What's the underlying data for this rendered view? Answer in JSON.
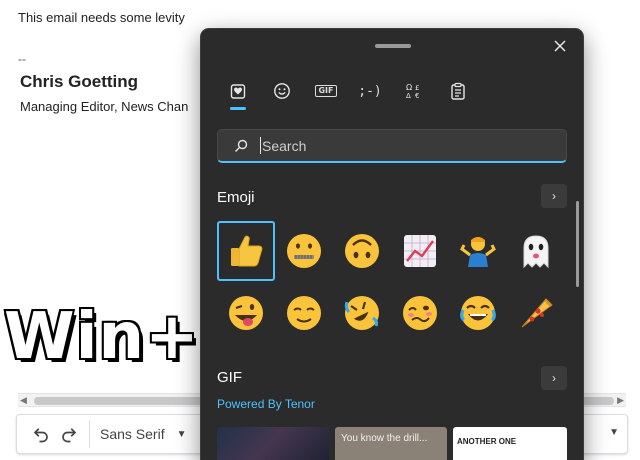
{
  "email": {
    "body_text": "This email needs some levity",
    "sig_dashes": "--",
    "sig_name": "Chris Goetting",
    "sig_title": "Managing Editor, News Chan"
  },
  "overlay_text": "Win+.",
  "toolbar": {
    "font_name": "Sans Serif",
    "undo_icon": "undo-icon",
    "redo_icon": "redo-icon"
  },
  "panel": {
    "tabs": [
      {
        "name": "recent-tab",
        "icon": "heart-clipboard-icon",
        "active": true
      },
      {
        "name": "emoji-tab",
        "icon": "smiley-icon"
      },
      {
        "name": "gif-tab",
        "label": "GIF"
      },
      {
        "name": "kaomoji-tab",
        "label": ";-)"
      },
      {
        "name": "symbols-tab",
        "label": "Ω"
      },
      {
        "name": "clipboard-tab",
        "icon": "clipboard-icon"
      }
    ],
    "search_placeholder": "Search",
    "emoji_section_title": "Emoji",
    "gif_section_title": "GIF",
    "powered_by": "Powered By Tenor",
    "emojis": [
      {
        "name": "thumbs-up",
        "char": "👍",
        "selected": true
      },
      {
        "name": "zipper-mouth",
        "char": "🤐"
      },
      {
        "name": "upside-down",
        "char": "🙃"
      },
      {
        "name": "chart-increasing",
        "char": "📈"
      },
      {
        "name": "person-shrugging",
        "char": "🤷"
      },
      {
        "name": "ghost",
        "char": "👻"
      },
      {
        "name": "winking-tongue",
        "char": "😜"
      },
      {
        "name": "relieved",
        "char": "😌"
      },
      {
        "name": "rolling-laughing",
        "char": "🤣"
      },
      {
        "name": "woozy",
        "char": "🥴"
      },
      {
        "name": "joy",
        "char": "😂"
      },
      {
        "name": "pizza",
        "char": "🍕"
      }
    ],
    "gifs": [
      {
        "caption": ""
      },
      {
        "caption": "You know the drill..."
      },
      {
        "caption": "ANOTHER ONE"
      }
    ]
  },
  "colors": {
    "panel_bg": "#2b2b2b",
    "accent": "#4cc2ff"
  }
}
